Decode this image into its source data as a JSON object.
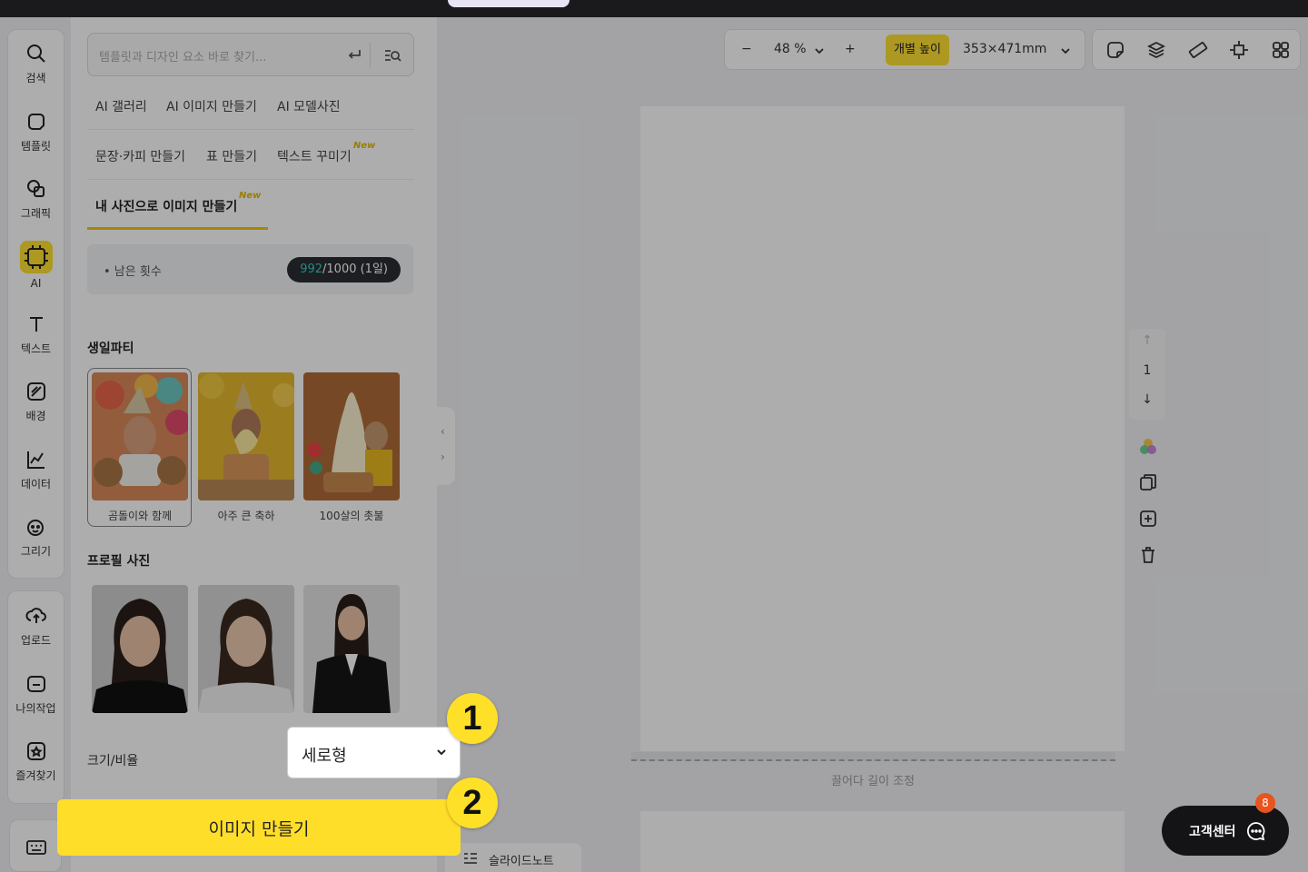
{
  "rail": {
    "items": [
      {
        "icon": "search-icon",
        "label": "검색"
      },
      {
        "icon": "template-icon",
        "label": "템플릿"
      },
      {
        "icon": "graphic-icon",
        "label": "그래픽"
      },
      {
        "icon": "ai-chip-icon",
        "label": "AI"
      },
      {
        "icon": "text-icon",
        "label": "텍스트"
      },
      {
        "icon": "background-icon",
        "label": "배경"
      },
      {
        "icon": "chart-icon",
        "label": "데이터"
      },
      {
        "icon": "draw-icon",
        "label": "그리기"
      }
    ],
    "items2": [
      {
        "icon": "upload-icon",
        "label": "업로드"
      },
      {
        "icon": "my-work-icon",
        "label": "나의작업"
      },
      {
        "icon": "favorite-icon",
        "label": "즐겨찾기"
      }
    ]
  },
  "search": {
    "placeholder": "템플릿과 디자인 요소 바로 찾기..."
  },
  "nav": {
    "row1": [
      "AI 갤러리",
      "AI 이미지 만들기",
      "AI 모델사진"
    ],
    "row2": [
      "문장·카피 만들기",
      "표 만들기",
      "텍스트 꾸미기"
    ],
    "row3": [
      "내 사진으로 이미지 만들기"
    ],
    "new_badge": "New"
  },
  "remain": {
    "label": "• 남은 횟수",
    "used": "992",
    "rest": "/1000 (1일)"
  },
  "birthday": {
    "title": "생일파티",
    "items": [
      "곰돌이와 함께",
      "아주 큰 축하",
      "100살의 촛불"
    ]
  },
  "profile": {
    "title": "프로필 사진"
  },
  "size": {
    "label": "크기/비율",
    "value": "세로형"
  },
  "make_button": "이미지 만들기",
  "steps": [
    "1",
    "2"
  ],
  "zoom": {
    "value": "48 %",
    "chip": "개별 높이",
    "dimensions": "353×471mm",
    "minus": "−",
    "plus": "+"
  },
  "page_number": "1",
  "resize_label": "끌어다 길이 조정",
  "slide_note": "슬라이드노트",
  "support": {
    "label": "고객센터",
    "count": "8"
  },
  "colors": {
    "accent": "#ffe033",
    "teal": "#2ed1c4",
    "badge": "#e8541e"
  }
}
